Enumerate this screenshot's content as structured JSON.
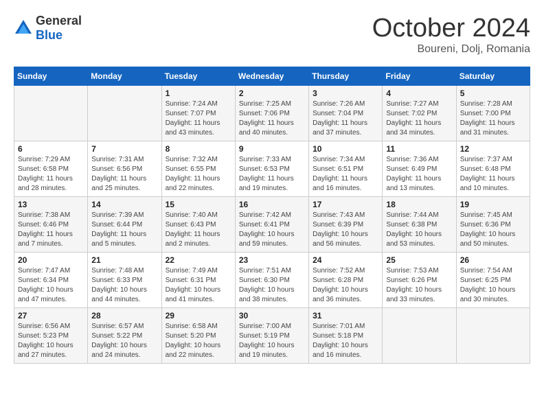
{
  "logo": {
    "general": "General",
    "blue": "Blue"
  },
  "title": "October 2024",
  "location": "Boureni, Dolj, Romania",
  "days_of_week": [
    "Sunday",
    "Monday",
    "Tuesday",
    "Wednesday",
    "Thursday",
    "Friday",
    "Saturday"
  ],
  "weeks": [
    [
      {
        "day": "",
        "sunrise": "",
        "sunset": "",
        "daylight": ""
      },
      {
        "day": "",
        "sunrise": "",
        "sunset": "",
        "daylight": ""
      },
      {
        "day": "1",
        "sunrise": "Sunrise: 7:24 AM",
        "sunset": "Sunset: 7:07 PM",
        "daylight": "Daylight: 11 hours and 43 minutes."
      },
      {
        "day": "2",
        "sunrise": "Sunrise: 7:25 AM",
        "sunset": "Sunset: 7:06 PM",
        "daylight": "Daylight: 11 hours and 40 minutes."
      },
      {
        "day": "3",
        "sunrise": "Sunrise: 7:26 AM",
        "sunset": "Sunset: 7:04 PM",
        "daylight": "Daylight: 11 hours and 37 minutes."
      },
      {
        "day": "4",
        "sunrise": "Sunrise: 7:27 AM",
        "sunset": "Sunset: 7:02 PM",
        "daylight": "Daylight: 11 hours and 34 minutes."
      },
      {
        "day": "5",
        "sunrise": "Sunrise: 7:28 AM",
        "sunset": "Sunset: 7:00 PM",
        "daylight": "Daylight: 11 hours and 31 minutes."
      }
    ],
    [
      {
        "day": "6",
        "sunrise": "Sunrise: 7:29 AM",
        "sunset": "Sunset: 6:58 PM",
        "daylight": "Daylight: 11 hours and 28 minutes."
      },
      {
        "day": "7",
        "sunrise": "Sunrise: 7:31 AM",
        "sunset": "Sunset: 6:56 PM",
        "daylight": "Daylight: 11 hours and 25 minutes."
      },
      {
        "day": "8",
        "sunrise": "Sunrise: 7:32 AM",
        "sunset": "Sunset: 6:55 PM",
        "daylight": "Daylight: 11 hours and 22 minutes."
      },
      {
        "day": "9",
        "sunrise": "Sunrise: 7:33 AM",
        "sunset": "Sunset: 6:53 PM",
        "daylight": "Daylight: 11 hours and 19 minutes."
      },
      {
        "day": "10",
        "sunrise": "Sunrise: 7:34 AM",
        "sunset": "Sunset: 6:51 PM",
        "daylight": "Daylight: 11 hours and 16 minutes."
      },
      {
        "day": "11",
        "sunrise": "Sunrise: 7:36 AM",
        "sunset": "Sunset: 6:49 PM",
        "daylight": "Daylight: 11 hours and 13 minutes."
      },
      {
        "day": "12",
        "sunrise": "Sunrise: 7:37 AM",
        "sunset": "Sunset: 6:48 PM",
        "daylight": "Daylight: 11 hours and 10 minutes."
      }
    ],
    [
      {
        "day": "13",
        "sunrise": "Sunrise: 7:38 AM",
        "sunset": "Sunset: 6:46 PM",
        "daylight": "Daylight: 11 hours and 7 minutes."
      },
      {
        "day": "14",
        "sunrise": "Sunrise: 7:39 AM",
        "sunset": "Sunset: 6:44 PM",
        "daylight": "Daylight: 11 hours and 5 minutes."
      },
      {
        "day": "15",
        "sunrise": "Sunrise: 7:40 AM",
        "sunset": "Sunset: 6:43 PM",
        "daylight": "Daylight: 11 hours and 2 minutes."
      },
      {
        "day": "16",
        "sunrise": "Sunrise: 7:42 AM",
        "sunset": "Sunset: 6:41 PM",
        "daylight": "Daylight: 10 hours and 59 minutes."
      },
      {
        "day": "17",
        "sunrise": "Sunrise: 7:43 AM",
        "sunset": "Sunset: 6:39 PM",
        "daylight": "Daylight: 10 hours and 56 minutes."
      },
      {
        "day": "18",
        "sunrise": "Sunrise: 7:44 AM",
        "sunset": "Sunset: 6:38 PM",
        "daylight": "Daylight: 10 hours and 53 minutes."
      },
      {
        "day": "19",
        "sunrise": "Sunrise: 7:45 AM",
        "sunset": "Sunset: 6:36 PM",
        "daylight": "Daylight: 10 hours and 50 minutes."
      }
    ],
    [
      {
        "day": "20",
        "sunrise": "Sunrise: 7:47 AM",
        "sunset": "Sunset: 6:34 PM",
        "daylight": "Daylight: 10 hours and 47 minutes."
      },
      {
        "day": "21",
        "sunrise": "Sunrise: 7:48 AM",
        "sunset": "Sunset: 6:33 PM",
        "daylight": "Daylight: 10 hours and 44 minutes."
      },
      {
        "day": "22",
        "sunrise": "Sunrise: 7:49 AM",
        "sunset": "Sunset: 6:31 PM",
        "daylight": "Daylight: 10 hours and 41 minutes."
      },
      {
        "day": "23",
        "sunrise": "Sunrise: 7:51 AM",
        "sunset": "Sunset: 6:30 PM",
        "daylight": "Daylight: 10 hours and 38 minutes."
      },
      {
        "day": "24",
        "sunrise": "Sunrise: 7:52 AM",
        "sunset": "Sunset: 6:28 PM",
        "daylight": "Daylight: 10 hours and 36 minutes."
      },
      {
        "day": "25",
        "sunrise": "Sunrise: 7:53 AM",
        "sunset": "Sunset: 6:26 PM",
        "daylight": "Daylight: 10 hours and 33 minutes."
      },
      {
        "day": "26",
        "sunrise": "Sunrise: 7:54 AM",
        "sunset": "Sunset: 6:25 PM",
        "daylight": "Daylight: 10 hours and 30 minutes."
      }
    ],
    [
      {
        "day": "27",
        "sunrise": "Sunrise: 6:56 AM",
        "sunset": "Sunset: 5:23 PM",
        "daylight": "Daylight: 10 hours and 27 minutes."
      },
      {
        "day": "28",
        "sunrise": "Sunrise: 6:57 AM",
        "sunset": "Sunset: 5:22 PM",
        "daylight": "Daylight: 10 hours and 24 minutes."
      },
      {
        "day": "29",
        "sunrise": "Sunrise: 6:58 AM",
        "sunset": "Sunset: 5:20 PM",
        "daylight": "Daylight: 10 hours and 22 minutes."
      },
      {
        "day": "30",
        "sunrise": "Sunrise: 7:00 AM",
        "sunset": "Sunset: 5:19 PM",
        "daylight": "Daylight: 10 hours and 19 minutes."
      },
      {
        "day": "31",
        "sunrise": "Sunrise: 7:01 AM",
        "sunset": "Sunset: 5:18 PM",
        "daylight": "Daylight: 10 hours and 16 minutes."
      },
      {
        "day": "",
        "sunrise": "",
        "sunset": "",
        "daylight": ""
      },
      {
        "day": "",
        "sunrise": "",
        "sunset": "",
        "daylight": ""
      }
    ]
  ]
}
